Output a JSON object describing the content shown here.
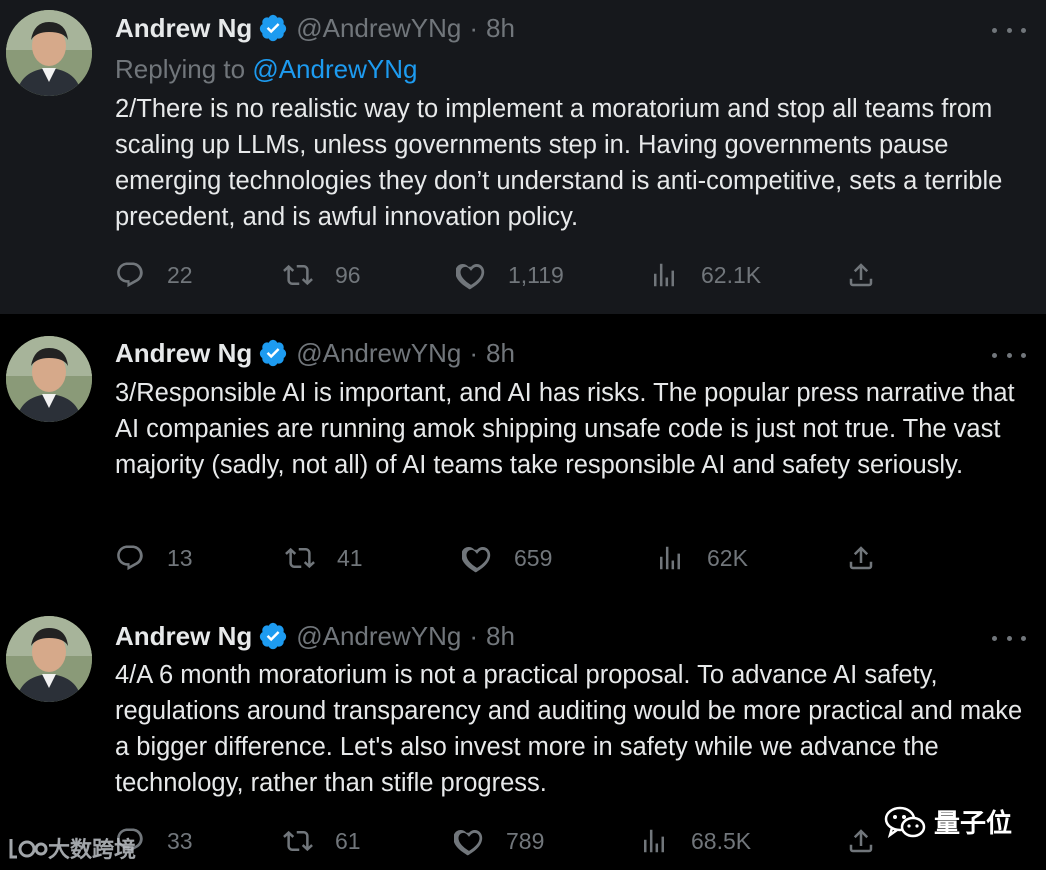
{
  "tweets": [
    {
      "author": "Andrew Ng",
      "handle": "@AndrewYNg",
      "separator": "·",
      "time": "8h",
      "replying_label": "Replying to",
      "replying_to": "@AndrewYNg",
      "text": "2/There is no realistic way to implement a moratorium and stop all teams from scaling up LLMs, unless governments step in. Having governments pause emerging technologies they don’t understand is anti-competitive, sets a terrible precedent, and is awful innovation policy.",
      "replies": "22",
      "retweets": "96",
      "likes": "1,119",
      "views": "62.1K"
    },
    {
      "author": "Andrew Ng",
      "handle": "@AndrewYNg",
      "separator": "·",
      "time": "8h",
      "text": "3/Responsible AI is important, and AI has risks. The popular press narrative that AI companies are running amok shipping unsafe code is just not true. The vast majority (sadly, not all) of AI teams take responsible AI and safety seriously.",
      "replies": "13",
      "retweets": "41",
      "likes": "659",
      "views": "62K"
    },
    {
      "author": "Andrew Ng",
      "handle": "@AndrewYNg",
      "separator": "·",
      "time": "8h",
      "text": "4/A 6 month moratorium is not a practical proposal. To advance AI safety, regulations around transparency and auditing would be more practical and make a bigger difference. Let's also invest more in safety while we advance the technology, rather than stifle progress.",
      "replies": "33",
      "retweets": "61",
      "likes": "789",
      "views": "68.5K"
    }
  ],
  "icons": {
    "reply": "reply-icon",
    "retweet": "retweet-icon",
    "like": "heart-icon",
    "views": "views-icon",
    "share": "share-icon",
    "verified": "verified-badge-icon",
    "more": "more-icon"
  },
  "watermarks": {
    "left_text": "大数跨境",
    "right_text": "量子位"
  },
  "colors": {
    "background": "#000000",
    "highlight_background": "#16181c",
    "text": "#e7e9ea",
    "muted": "#71767b",
    "accent": "#1d9bf0"
  }
}
